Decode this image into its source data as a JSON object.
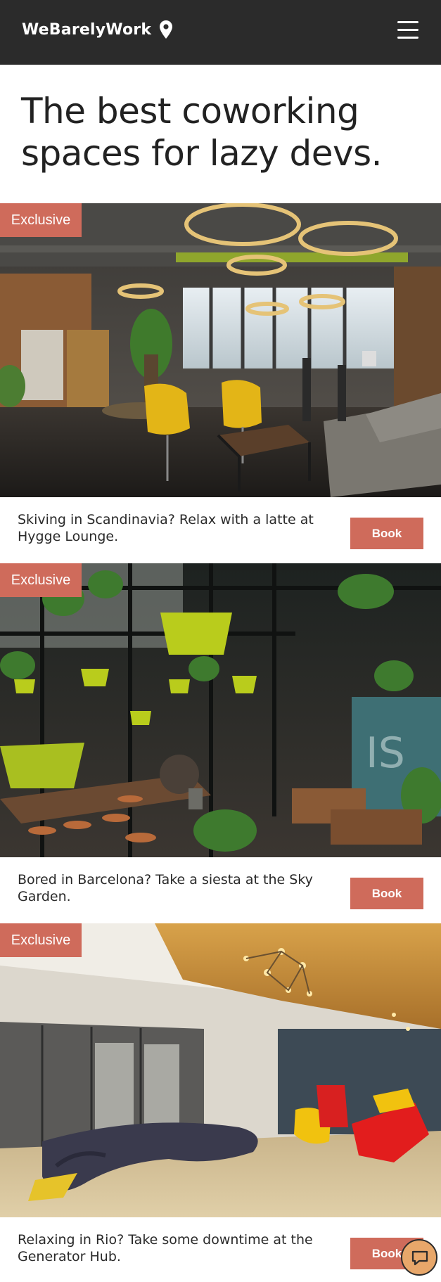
{
  "header": {
    "brand": "WeBarelyWork",
    "location_icon": "map-pin-icon",
    "menu_icon": "hamburger-menu-icon"
  },
  "hero": {
    "title": "The best coworking spaces for lazy devs."
  },
  "listings": [
    {
      "badge": "Exclusive",
      "caption": "Skiving in Scandinavia? Relax with a latte at Hygge Lounge.",
      "button": "Book"
    },
    {
      "badge": "Exclusive",
      "caption": "Bored in Barcelona? Take a siesta at the Sky Garden.",
      "button": "Book"
    },
    {
      "badge": "Exclusive",
      "caption": "Relaxing in Rio? Take some downtime at the Generator Hub.",
      "button": "Book"
    }
  ],
  "chat": {
    "icon": "chat-bubble-icon"
  },
  "colors": {
    "header_bg": "#2b2b2b",
    "accent": "#cf6b5b",
    "chat_bg": "#e8a76a"
  }
}
